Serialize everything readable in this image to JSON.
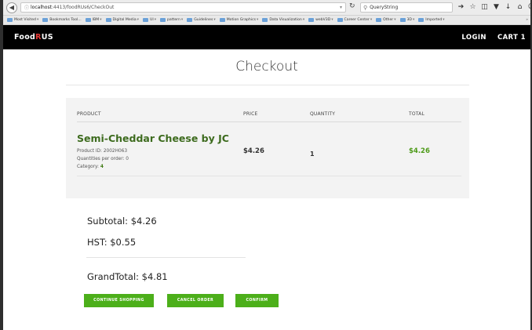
{
  "browser": {
    "url_host": "localhost",
    "url_path": ":4413/foodRUs6/CheckOut",
    "search_value": "QueryString",
    "bookmarks": [
      "Most Visited",
      "Bookmarks Tool...",
      "IBM",
      "Digital Media",
      "UI",
      "pattern",
      "Guidelines",
      "Motion Graphics",
      "Data Visualization",
      "webV3D",
      "Career Center",
      "Other",
      "3D",
      "Imported"
    ],
    "more": "»"
  },
  "site": {
    "logo_pre": "Food",
    "logo_r": "R",
    "logo_post": "US",
    "login": "LOGIN",
    "cart": "CART 1"
  },
  "page": {
    "title": "Checkout"
  },
  "table": {
    "headers": [
      "PRODUCT",
      "PRICE",
      "QUANTITY",
      "TOTAL"
    ],
    "row": {
      "name": "Semi-Cheddar Cheese by JC",
      "product_id_label": "Product ID: ",
      "product_id": "2002H063",
      "qpo_label": "Quantities per order: ",
      "qpo": "0",
      "category_label": "Category: ",
      "category": "4",
      "price": "$4.26",
      "quantity": "1",
      "total": "$4.26"
    }
  },
  "totals": {
    "subtotal": "Subtotal: $4.26",
    "hst": "HST: $0.55",
    "grand": "GrandTotal: $4.81"
  },
  "buttons": {
    "continue": "CONTINUE SHOPPING",
    "cancel": "CANCEL ORDER",
    "confirm": "CONFIRM"
  },
  "colors": {
    "accent_green": "#4caf1a",
    "product_green": "#3d6b1e",
    "header_bg": "#000000",
    "logo_red": "#e53935"
  }
}
